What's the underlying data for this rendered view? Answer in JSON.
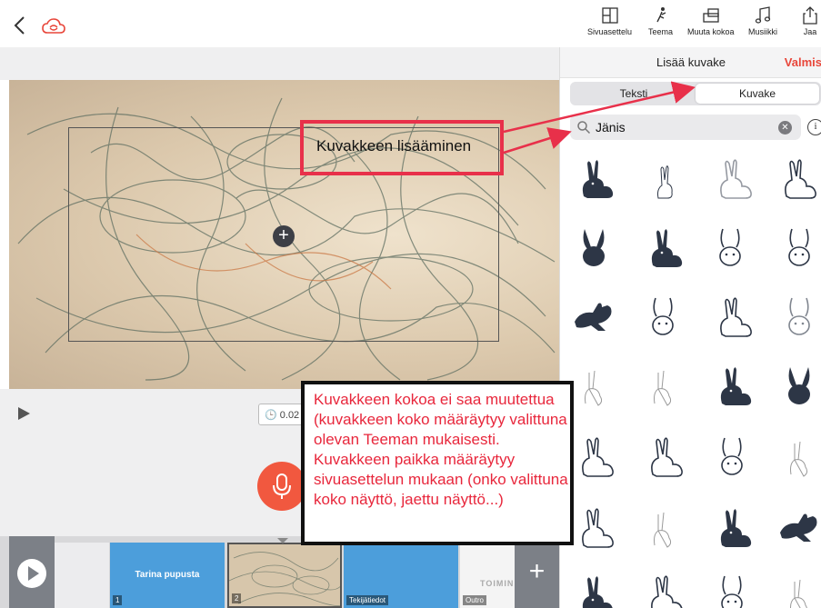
{
  "toolbar": {
    "items": [
      {
        "label": "Sivuasettelu",
        "icon": "layout-icon"
      },
      {
        "label": "Teema",
        "icon": "theme-icon"
      },
      {
        "label": "Muuta kokoa",
        "icon": "resize-icon"
      },
      {
        "label": "Musiikki",
        "icon": "music-icon"
      },
      {
        "label": "Jaa",
        "icon": "share-icon"
      }
    ]
  },
  "editor": {
    "timer": "0.02",
    "add_symbol": "+"
  },
  "timeline": {
    "clips": [
      {
        "title": "Tarina pupusta",
        "number": "1"
      },
      {
        "title": "",
        "number": "2"
      },
      {
        "title": "",
        "number": "Tekijätiedot"
      },
      {
        "title": "TOIMIN",
        "number": "Outro"
      }
    ],
    "add_symbol": "+"
  },
  "panel": {
    "title": "Lisää kuvake",
    "done": "Valmis",
    "tabs": {
      "text": "Teksti",
      "icon": "Kuvake"
    },
    "search_value": "Jänis",
    "info": "i"
  },
  "annotations": {
    "red_box": "Kuvakkeen lisääminen",
    "black_box": "Kuvakkeen kokoa ei saa muutettua (kuvakkeen koko määräytyy valittuna olevan Teeman mukaisesti. Kuvakkeen paikka määräytyy sivuasettelun mukaan (onko valittuna koko näyttö, jaettu näyttö...)"
  },
  "colors": {
    "accent": "#e8463a",
    "mic": "#f1583f",
    "clip_blue": "#4c9edb",
    "annotation_red": "#e8304a"
  }
}
